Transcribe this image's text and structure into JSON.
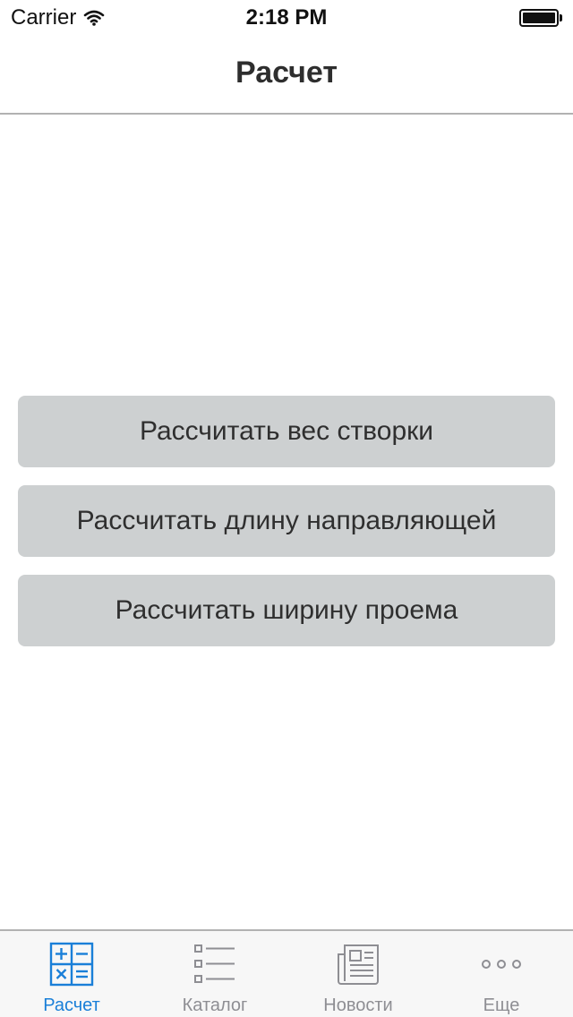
{
  "status_bar": {
    "carrier": "Carrier",
    "time": "2:18 PM"
  },
  "nav": {
    "title": "Расчет"
  },
  "actions": [
    {
      "label": "Рассчитать вес створки"
    },
    {
      "label": "Рассчитать длину направляющей"
    },
    {
      "label": "Рассчитать ширину проема"
    }
  ],
  "tabs": [
    {
      "label": "Расчет",
      "icon": "calculator-icon",
      "active": true
    },
    {
      "label": "Каталог",
      "icon": "list-icon",
      "active": false
    },
    {
      "label": "Новости",
      "icon": "newspaper-icon",
      "active": false
    },
    {
      "label": "Еще",
      "icon": "more-icon",
      "active": false
    }
  ],
  "colors": {
    "accent": "#1a7fd8",
    "button_bg": "#cdd0d1",
    "tab_inactive": "#8e8e93"
  }
}
